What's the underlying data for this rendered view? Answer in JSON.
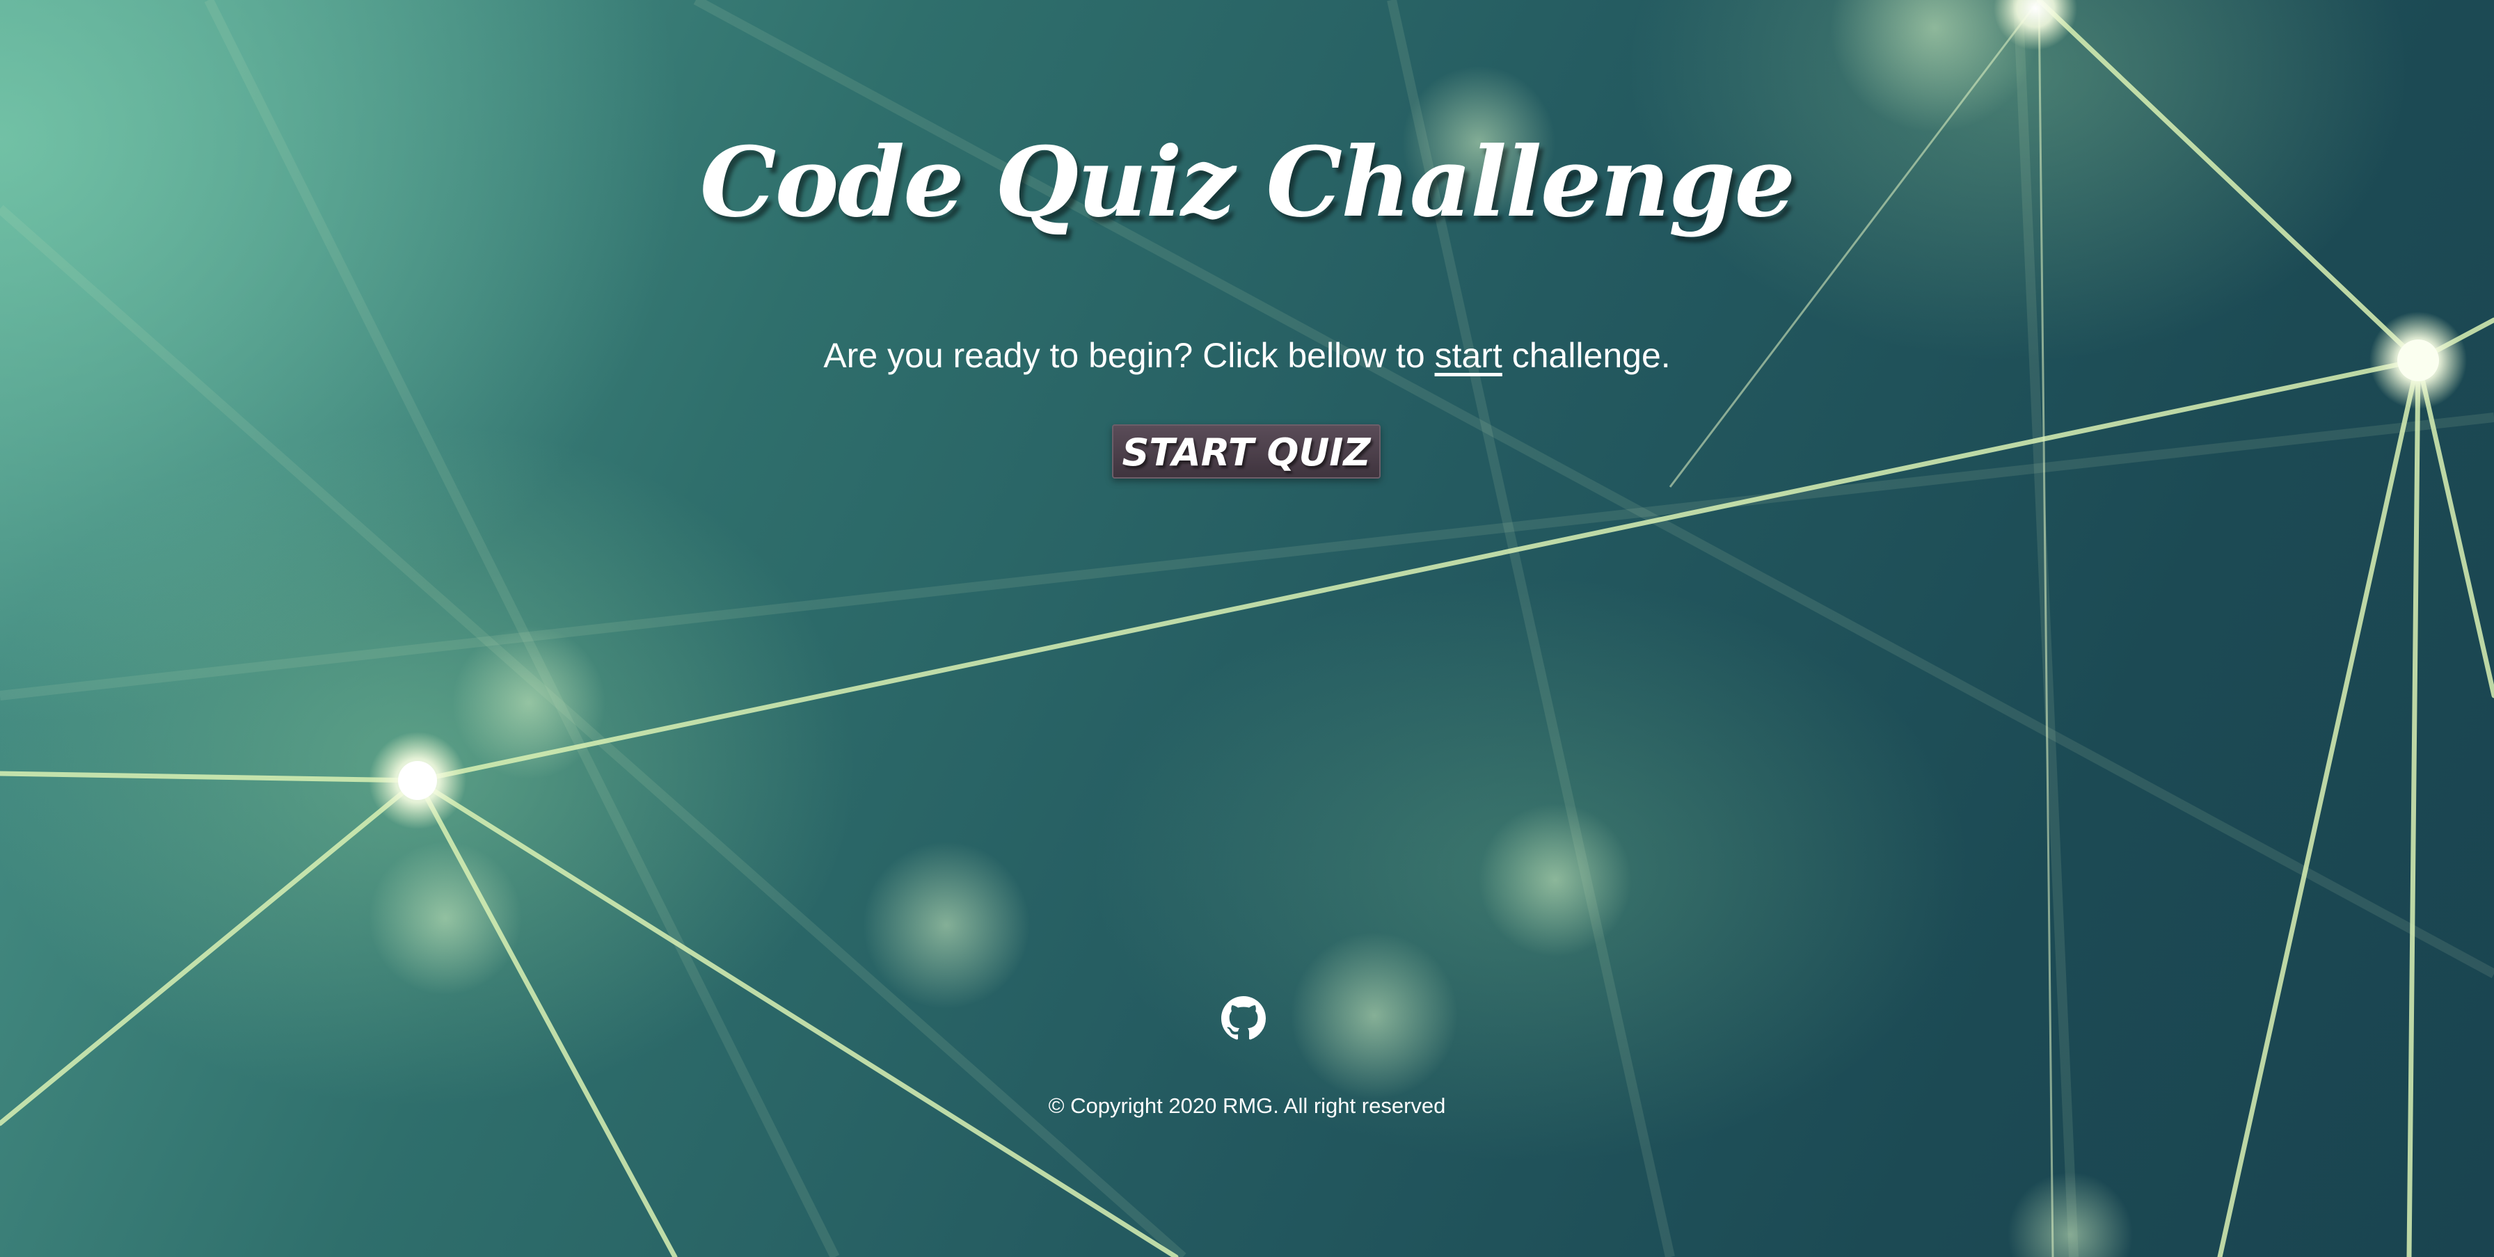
{
  "header": {
    "title": "Code Quiz Challenge"
  },
  "intro": {
    "text_before": "Are you ready to begin? Click bellow to ",
    "link_word": "start",
    "text_after": " challenge."
  },
  "start_button": {
    "label": "START QUIZ"
  },
  "footer": {
    "github_icon": "github-icon",
    "copyright": "© Copyright 2020 RMG. All right reserved"
  },
  "colors": {
    "text": "#ffffff",
    "button_bg": "#4a3e49",
    "background_dark": "#1c4a54",
    "background_light": "#4f9a8c",
    "network_lines": "#d8f0b0"
  }
}
